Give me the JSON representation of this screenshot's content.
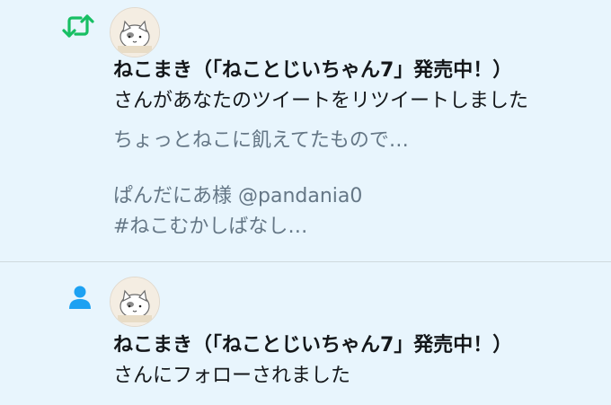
{
  "notifications": [
    {
      "type": "retweet",
      "type_icon": "retweet-icon",
      "accent_color": "#17bf63",
      "user_name": "ねこまき（「ねことじいちゃん7」発売中！）",
      "action_text": "さんがあなたのツイートをリツイートしました",
      "tweet_preview_line1": "ちょっとねこに飢えてたもので…",
      "tweet_preview_line2": "ぱんだにあ様 @pandania0",
      "tweet_preview_line3": "#ねこむかしばなし…"
    },
    {
      "type": "follow",
      "type_icon": "person-icon",
      "accent_color": "#1da1f2",
      "user_name": "ねこまき（「ねことじいちゃん7」発売中！）",
      "action_text": "さんにフォローされました"
    }
  ]
}
